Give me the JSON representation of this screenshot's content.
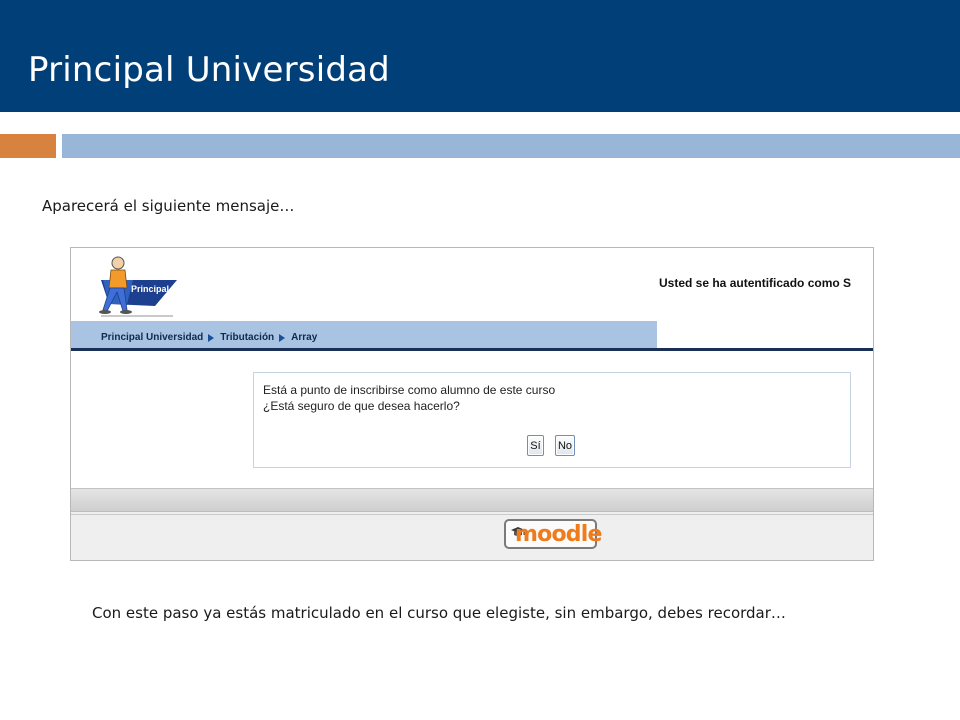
{
  "slide": {
    "title": "Principal Universidad",
    "intro": "Aparecerá el siguiente mensaje…",
    "outro": "Con este paso ya estás matriculado en el curso que elegiste, sin embargo, debes recordar…"
  },
  "screenshot": {
    "logo_label": "Principal",
    "user_status": "Usted se ha autentificado como S",
    "breadcrumb": [
      "Principal Universidad",
      "Tributación",
      "Array"
    ],
    "message_line_1": "Está a punto de inscribirse como alumno de este curso",
    "message_line_2": "¿Está seguro de que desea hacerlo?",
    "yes_label": "Sí",
    "no_label": "No",
    "footer_logo": "moodle"
  },
  "colors": {
    "title_bar": "#003f78",
    "accent_orange": "#d8823f",
    "accent_blue": "#97b6d8",
    "nav_bar": "#a9c4e2",
    "moodle_orange": "#f07b1b"
  }
}
